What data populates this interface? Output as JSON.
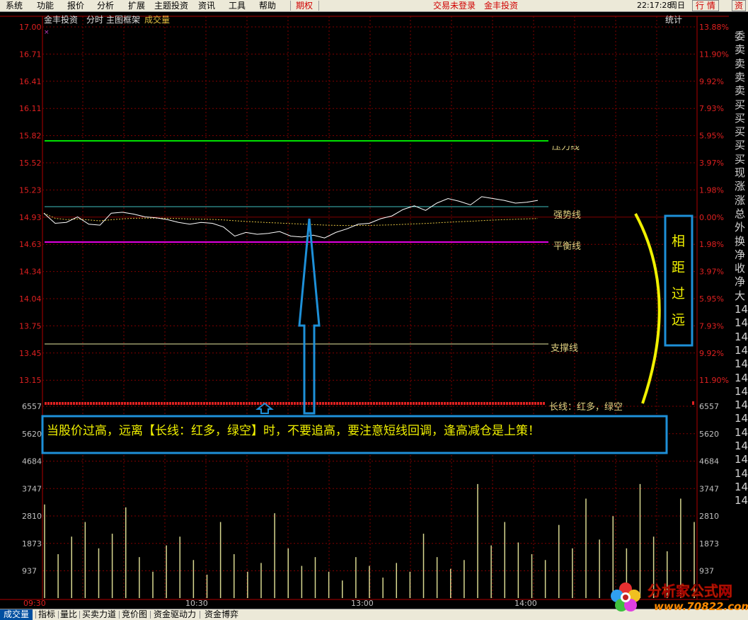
{
  "menu": {
    "items": [
      "系统",
      "功能",
      "报价",
      "分析",
      "扩展",
      "主题投资",
      "资讯",
      "工具",
      "帮助"
    ],
    "options_label": "期权",
    "trade_status": "交易未登录",
    "broker": "金丰投资",
    "clock": "22:17:28",
    "weekday": "周日",
    "btn_quote": "行 情",
    "btn_info": "资"
  },
  "chart_header": {
    "stock": "金丰投资",
    "mode": "分时",
    "frame": "主图框架",
    "indicator": "成交量",
    "stats_label": "统计"
  },
  "price_axis": {
    "left": [
      "17.00",
      "16.71",
      "16.41",
      "16.11",
      "15.82",
      "15.52",
      "15.23",
      "14.93",
      "14.63",
      "14.34",
      "14.04",
      "13.75",
      "13.45",
      "13.15"
    ],
    "right": [
      "13.88%",
      "11.90%",
      "9.92%",
      "7.93%",
      "5.95%",
      "3.97%",
      "1.98%",
      "0.00%",
      "1.98%",
      "3.97%",
      "5.95%",
      "7.93%",
      "9.92%",
      "11.90%"
    ]
  },
  "volume_axis": {
    "labels": [
      "6557",
      "5620",
      "4684",
      "3747",
      "2810",
      "1873",
      "937"
    ]
  },
  "time_axis": {
    "labels": [
      "09:30",
      "10:30",
      "13:00",
      "14:00"
    ]
  },
  "lines": {
    "pressure": {
      "label": "压力线",
      "color": "#00e000"
    },
    "strong": {
      "label": "强势线",
      "color": "#40c0c0"
    },
    "balance": {
      "label": "平衡线",
      "color": "#e000e0"
    },
    "support": {
      "label": "支撑线",
      "color": "#e8e8a0"
    },
    "long_line": {
      "label": "长线：红多，绿空",
      "color": "#e02020"
    }
  },
  "price_series": [
    14.97,
    14.86,
    14.87,
    14.93,
    14.85,
    14.84,
    14.97,
    14.98,
    14.96,
    14.93,
    14.92,
    14.9,
    14.87,
    14.85,
    14.87,
    14.86,
    14.82,
    14.72,
    14.76,
    14.74,
    14.75,
    14.77,
    14.72,
    14.71,
    14.73,
    14.7,
    14.76,
    14.8,
    14.85,
    14.86,
    14.91,
    14.94,
    15.01,
    15.05,
    15.0,
    15.08,
    15.13,
    15.1,
    15.06,
    15.15,
    15.13,
    15.11,
    15.08,
    15.09,
    15.11
  ],
  "volume_series": [
    3200,
    1500,
    2100,
    2600,
    1700,
    2200,
    3100,
    1400,
    900,
    1800,
    2100,
    1300,
    800,
    2600,
    1500,
    900,
    1200,
    2900,
    1700,
    1100,
    1400,
    900,
    600,
    1400,
    1100,
    700,
    1200,
    900,
    2200,
    1400,
    1000,
    1300,
    3900,
    1800,
    2600,
    1900,
    1500,
    1300,
    2500,
    1700,
    3400,
    2000,
    2800,
    1700,
    3900,
    2100,
    1600,
    3400,
    2600
  ],
  "annotations": {
    "main_text": "当股价过高，远离【长线：红多，绿空】时，不要追高，要注意短线回调，逢高减仓是上策！",
    "side_text": [
      "相",
      "距",
      "过",
      "远"
    ],
    "accent_blue": "#1e90d8",
    "accent_yellow": "#f0f000"
  },
  "right_panel": [
    "委",
    "卖",
    "卖",
    "卖",
    "卖",
    "买",
    "买",
    "买",
    "买",
    "买",
    "现",
    "涨",
    "涨",
    "总",
    "外",
    "换",
    "净",
    "收",
    "净",
    "大",
    "14",
    "14",
    "14",
    "14",
    "14",
    "14",
    "14",
    "14",
    "14",
    "14",
    "14",
    "14",
    "14",
    "14",
    "14"
  ],
  "tabs": [
    "成交量",
    "指标",
    "量比",
    "买卖力道",
    "竞价图",
    "资金驱动力",
    "资金博弈"
  ],
  "watermark": {
    "title": "分析家公式网",
    "url": "www.70822.com"
  }
}
